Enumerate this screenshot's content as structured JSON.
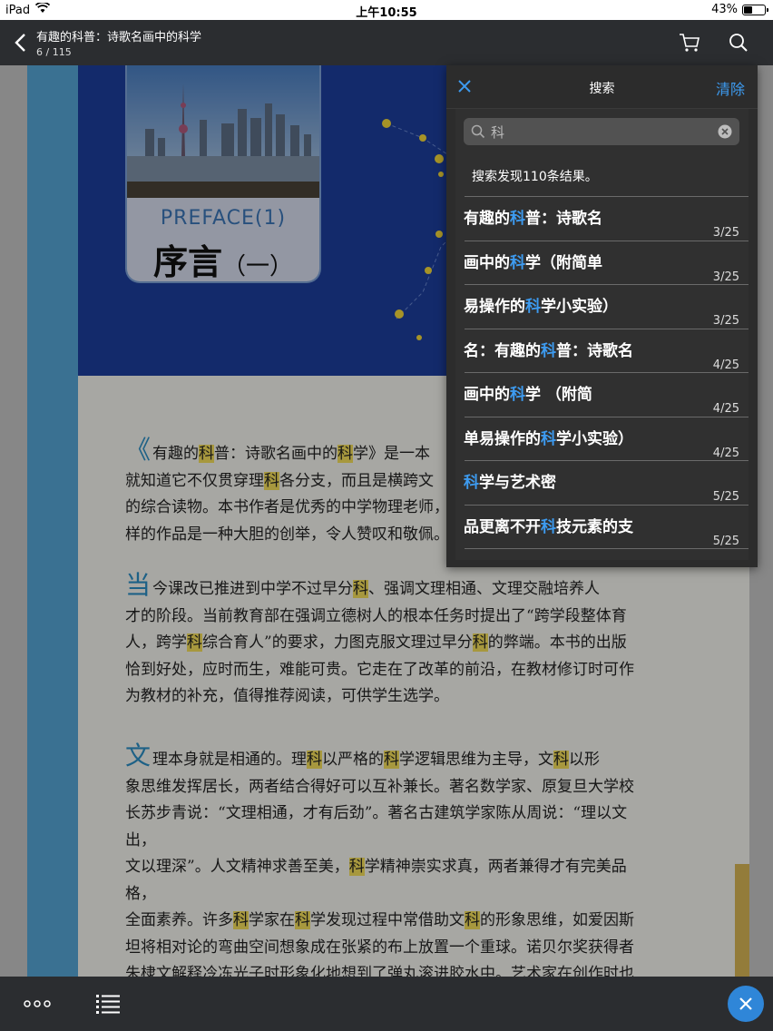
{
  "status_bar": {
    "device": "iPad",
    "time": "上午10:55",
    "battery": "43%",
    "battery_level": 0.43
  },
  "nav": {
    "title": "有趣的科普：诗歌名画中的科学",
    "pages": "6 / 115"
  },
  "book": {
    "preface_en": "PREFACE(1)",
    "preface_cn": "序言",
    "preface_num": "（一）",
    "p1": [
      {
        "t": "有趣的"
      },
      {
        "t": "科",
        "h": true
      },
      {
        "t": "普：诗歌名画中的"
      },
      {
        "t": "科",
        "h": true
      },
      {
        "t": "学》是一本"
      }
    ],
    "p1_lines": [
      "就知道它不仅贯穿理科各分支，而且是横跨文",
      "的综合读物。本书作者是优秀的中学物理老师，",
      "样的作品是一种大胆的创举，令人赞叹和敬佩。"
    ],
    "p2_drop": "当",
    "p2_lines": [
      "今课改已推进到中学不过早分科、强调文理相通、文理交融培养人",
      "才的阶段。当前教育部在强调立德树人的根本任务时提出了“跨学段整体育",
      "人，跨学科综合育人”的要求，力图克服文理过早分科的弊端。本书的出版",
      "恰到好处，应时而生，难能可贵。它走在了改革的前沿，在教材修订时可作",
      "为教材的补充，值得推荐阅读，可供学生选学。"
    ],
    "p3_drop": "文",
    "p3_lines": [
      "理本身就是相通的。理科以严格的科学逻辑思维为主导，文科以形",
      "象思维发挥居长，两者结合得好可以互补兼长。著名数学家、原复旦大学校",
      "长苏步青说：“文理相通，才有后劲”。著名古建筑学家陈从周说：“理以文出，",
      "文以理深”。人文精神求善至美，科学精神崇实求真，两者兼得才有完美品格，",
      "全面素养。许多科学家在科学发现过程中常借助文科的形象思维，如爱因斯",
      "坦将相对论的弯曲空间想象成在张紧的布上放置一个重球。诺贝尔奖获得者",
      "朱棣文解释冷冻光子时形象化地想到了弹丸滚进胶水中。艺术家在创作时也"
    ]
  },
  "search": {
    "title": "搜索",
    "clear": "清除",
    "query": "科",
    "count_text": "搜索发现110条结果。",
    "results": [
      {
        "pre": "有趣的",
        "key": "科",
        "post": "普：诗歌名",
        "page": "3/25"
      },
      {
        "pre": "画中的",
        "key": "科",
        "post": "学（附简单",
        "page": "3/25"
      },
      {
        "pre": "易操作的",
        "key": "科",
        "post": "学小实验）",
        "page": "3/25"
      },
      {
        "pre": "名：有趣的",
        "key": "科",
        "post": "普：诗歌名",
        "page": "4/25"
      },
      {
        "pre": "画中的",
        "key": "科",
        "post": "学 （附简",
        "page": "4/25"
      },
      {
        "pre": "单易操作的",
        "key": "科",
        "post": "学小实验）",
        "page": "4/25"
      },
      {
        "pre": "",
        "key": "科",
        "post": "学与艺术密",
        "page": "5/25"
      },
      {
        "pre": "品更离不开",
        "key": "科",
        "post": "技元素的支",
        "page": "5/25"
      }
    ]
  },
  "colors": {
    "accent": "#3d9bf0",
    "toolbar": "#2b2d30",
    "highlight": "#f6e15c",
    "hero": "#1d3f9e",
    "spine": "#56a7d8"
  },
  "icons": [
    "wifi-icon",
    "back-chevron-icon",
    "cart-icon",
    "search-icon",
    "close-icon",
    "clear-input-icon",
    "more-icon",
    "toc-icon"
  ]
}
